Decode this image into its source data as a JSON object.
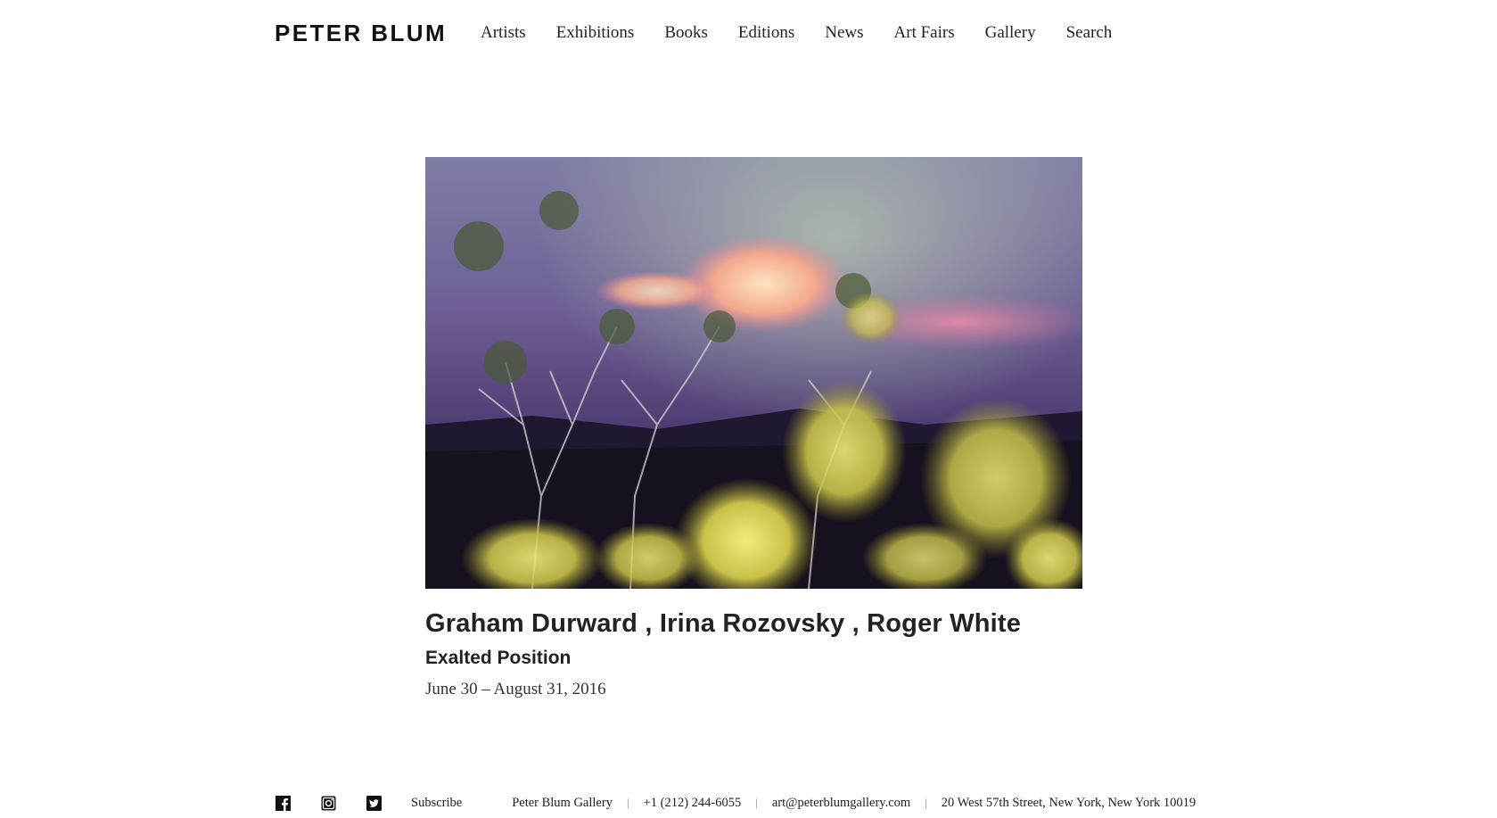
{
  "brand": {
    "logo": "PETER BLUM"
  },
  "nav": {
    "items": [
      {
        "label": "Artists"
      },
      {
        "label": "Exhibitions"
      },
      {
        "label": "Books"
      },
      {
        "label": "Editions"
      },
      {
        "label": "News"
      },
      {
        "label": "Art Fairs"
      },
      {
        "label": "Gallery"
      },
      {
        "label": "Search"
      }
    ]
  },
  "exhibition": {
    "artists": "Graham Durward , Irina Rozovsky , Roger White",
    "title": "Exalted Position",
    "dates": "June 30 – August 31, 2016"
  },
  "footer": {
    "social_icons": [
      "facebook-icon",
      "instagram-icon",
      "twitter-icon"
    ],
    "subscribe": "Subscribe",
    "gallery": "Peter Blum Gallery",
    "phone": "+1 (212) 244-6055",
    "email": "art@peterblumgallery.com",
    "address": "20 West 57th Street, New York, New York 10019",
    "separator": "|"
  },
  "colors": {
    "text": "#222222",
    "sky_top": "#8a7fa6",
    "sky_bottom": "#3b2c5c",
    "cloud": "#f4a98d",
    "foliage": "#d9d45a"
  }
}
